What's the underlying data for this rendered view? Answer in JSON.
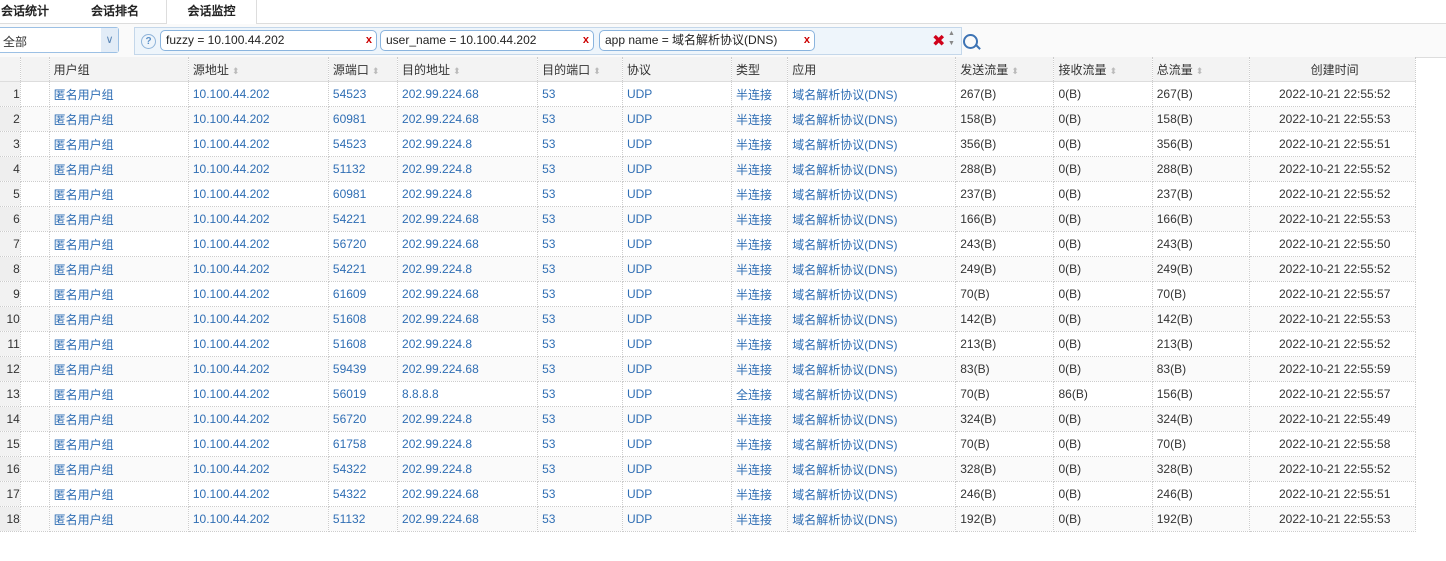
{
  "tabs": [
    "会话统计",
    "会话排名",
    "会话监控"
  ],
  "filter": {
    "select_value": "全部",
    "chips": [
      {
        "key": "fuzzy",
        "text": "fuzzy = 10.100.44.202"
      },
      {
        "key": "user_name",
        "text": "user_name =  10.100.44.202"
      },
      {
        "key": "app_name",
        "text": "app  name =  域名解析协议(DNS)"
      }
    ],
    "remove": "x",
    "help": "?"
  },
  "columns": [
    "用户组",
    "源地址",
    "源端口",
    "目的地址",
    "目的端口",
    "协议",
    "类型",
    "应用",
    "发送流量",
    "接收流量",
    "总流量",
    "创建时间"
  ],
  "rows": [
    [
      "1",
      "匿名用户组",
      "10.100.44.202",
      "54523",
      "202.99.224.68",
      "53",
      "UDP",
      "半连接",
      "域名解析协议(DNS)",
      "267(B)",
      "0(B)",
      "267(B)",
      "2022-10-21 22:55:52"
    ],
    [
      "2",
      "匿名用户组",
      "10.100.44.202",
      "60981",
      "202.99.224.68",
      "53",
      "UDP",
      "半连接",
      "域名解析协议(DNS)",
      "158(B)",
      "0(B)",
      "158(B)",
      "2022-10-21 22:55:53"
    ],
    [
      "3",
      "匿名用户组",
      "10.100.44.202",
      "54523",
      "202.99.224.8",
      "53",
      "UDP",
      "半连接",
      "域名解析协议(DNS)",
      "356(B)",
      "0(B)",
      "356(B)",
      "2022-10-21 22:55:51"
    ],
    [
      "4",
      "匿名用户组",
      "10.100.44.202",
      "51132",
      "202.99.224.8",
      "53",
      "UDP",
      "半连接",
      "域名解析协议(DNS)",
      "288(B)",
      "0(B)",
      "288(B)",
      "2022-10-21 22:55:52"
    ],
    [
      "5",
      "匿名用户组",
      "10.100.44.202",
      "60981",
      "202.99.224.8",
      "53",
      "UDP",
      "半连接",
      "域名解析协议(DNS)",
      "237(B)",
      "0(B)",
      "237(B)",
      "2022-10-21 22:55:52"
    ],
    [
      "6",
      "匿名用户组",
      "10.100.44.202",
      "54221",
      "202.99.224.68",
      "53",
      "UDP",
      "半连接",
      "域名解析协议(DNS)",
      "166(B)",
      "0(B)",
      "166(B)",
      "2022-10-21 22:55:53"
    ],
    [
      "7",
      "匿名用户组",
      "10.100.44.202",
      "56720",
      "202.99.224.68",
      "53",
      "UDP",
      "半连接",
      "域名解析协议(DNS)",
      "243(B)",
      "0(B)",
      "243(B)",
      "2022-10-21 22:55:50"
    ],
    [
      "8",
      "匿名用户组",
      "10.100.44.202",
      "54221",
      "202.99.224.8",
      "53",
      "UDP",
      "半连接",
      "域名解析协议(DNS)",
      "249(B)",
      "0(B)",
      "249(B)",
      "2022-10-21 22:55:52"
    ],
    [
      "9",
      "匿名用户组",
      "10.100.44.202",
      "61609",
      "202.99.224.68",
      "53",
      "UDP",
      "半连接",
      "域名解析协议(DNS)",
      "70(B)",
      "0(B)",
      "70(B)",
      "2022-10-21 22:55:57"
    ],
    [
      "10",
      "匿名用户组",
      "10.100.44.202",
      "51608",
      "202.99.224.68",
      "53",
      "UDP",
      "半连接",
      "域名解析协议(DNS)",
      "142(B)",
      "0(B)",
      "142(B)",
      "2022-10-21 22:55:53"
    ],
    [
      "11",
      "匿名用户组",
      "10.100.44.202",
      "51608",
      "202.99.224.8",
      "53",
      "UDP",
      "半连接",
      "域名解析协议(DNS)",
      "213(B)",
      "0(B)",
      "213(B)",
      "2022-10-21 22:55:52"
    ],
    [
      "12",
      "匿名用户组",
      "10.100.44.202",
      "59439",
      "202.99.224.68",
      "53",
      "UDP",
      "半连接",
      "域名解析协议(DNS)",
      "83(B)",
      "0(B)",
      "83(B)",
      "2022-10-21 22:55:59"
    ],
    [
      "13",
      "匿名用户组",
      "10.100.44.202",
      "56019",
      "8.8.8.8",
      "53",
      "UDP",
      "全连接",
      "域名解析协议(DNS)",
      "70(B)",
      "86(B)",
      "156(B)",
      "2022-10-21 22:55:57"
    ],
    [
      "14",
      "匿名用户组",
      "10.100.44.202",
      "56720",
      "202.99.224.8",
      "53",
      "UDP",
      "半连接",
      "域名解析协议(DNS)",
      "324(B)",
      "0(B)",
      "324(B)",
      "2022-10-21 22:55:49"
    ],
    [
      "15",
      "匿名用户组",
      "10.100.44.202",
      "61758",
      "202.99.224.8",
      "53",
      "UDP",
      "半连接",
      "域名解析协议(DNS)",
      "70(B)",
      "0(B)",
      "70(B)",
      "2022-10-21 22:55:58"
    ],
    [
      "16",
      "匿名用户组",
      "10.100.44.202",
      "54322",
      "202.99.224.8",
      "53",
      "UDP",
      "半连接",
      "域名解析协议(DNS)",
      "328(B)",
      "0(B)",
      "328(B)",
      "2022-10-21 22:55:52"
    ],
    [
      "17",
      "匿名用户组",
      "10.100.44.202",
      "54322",
      "202.99.224.68",
      "53",
      "UDP",
      "半连接",
      "域名解析协议(DNS)",
      "246(B)",
      "0(B)",
      "246(B)",
      "2022-10-21 22:55:51"
    ],
    [
      "18",
      "匿名用户组",
      "10.100.44.202",
      "51132",
      "202.99.224.68",
      "53",
      "UDP",
      "半连接",
      "域名解析协议(DNS)",
      "192(B)",
      "0(B)",
      "192(B)",
      "2022-10-21 22:55:53"
    ]
  ]
}
